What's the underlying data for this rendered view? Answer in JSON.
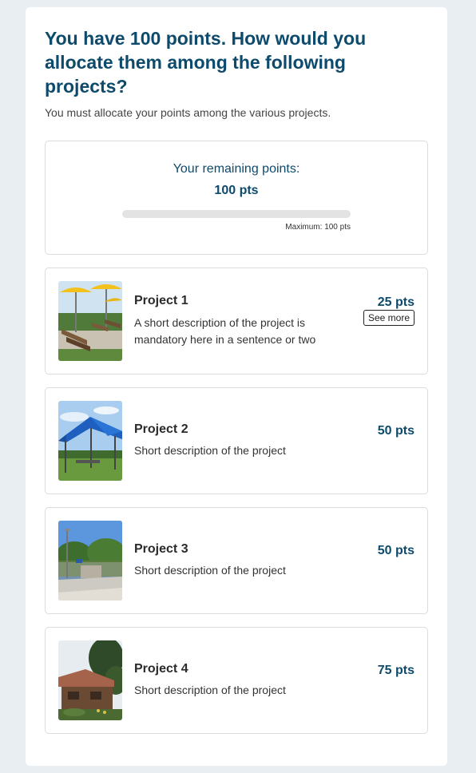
{
  "question": {
    "title": "You have 100 points. How would you allocate them among the following projects?",
    "subtitle": "You must allocate your points among the various projects."
  },
  "budget": {
    "label": "Your remaining points:",
    "remaining": "100 pts",
    "maximum_label": "Maximum: 100 pts",
    "used_fraction": 0
  },
  "projects": [
    {
      "title": "Project 1",
      "description": "A short description of the project is mandatory here in a sentence or two",
      "points": "25 pts",
      "see_more_label": "See more",
      "image_icon": "park-benches-umbrellas-photo"
    },
    {
      "title": "Project 2",
      "description": "Short description of the project",
      "points": "50 pts",
      "image_icon": "blue-shade-canopy-photo"
    },
    {
      "title": "Project 3",
      "description": "Short description of the project",
      "points": "50 pts",
      "image_icon": "fenced-court-photo"
    },
    {
      "title": "Project 4",
      "description": "Short description of the project",
      "points": "75 pts",
      "image_icon": "chalet-building-photo"
    }
  ],
  "colors": {
    "accent": "#0d4a6b",
    "page_background": "#e9eef2",
    "border": "#dcdcdc"
  }
}
